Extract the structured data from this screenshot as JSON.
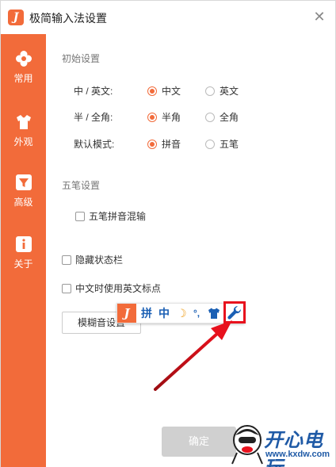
{
  "window": {
    "title": "极简输入法设置",
    "logo_letter": "J",
    "close_glyph": "✕"
  },
  "sidebar": {
    "items": [
      {
        "label": "常用",
        "icon": "flower-icon"
      },
      {
        "label": "外观",
        "icon": "tshirt-icon"
      },
      {
        "label": "高级",
        "icon": "funnel-icon"
      },
      {
        "label": "关于",
        "icon": "info-icon"
      }
    ]
  },
  "initial_settings": {
    "title": "初始设置",
    "rows": [
      {
        "label": "中 / 英文:",
        "options": [
          "中文",
          "英文"
        ],
        "selected": "中文"
      },
      {
        "label": "半 / 全角:",
        "options": [
          "半角",
          "全角"
        ],
        "selected": "半角"
      },
      {
        "label": "默认模式:",
        "options": [
          "拼音",
          "五笔"
        ],
        "selected": "拼音"
      }
    ]
  },
  "wubi_settings": {
    "title": "五笔设置",
    "mix_label": "五笔拼音混输"
  },
  "options": {
    "hide_status_bar": "隐藏状态栏",
    "english_punct": "中文时使用英文标点"
  },
  "fuzzy_button": "模糊音设置",
  "confirm_button": "确定",
  "floating_toolbar": {
    "logo_letter": "J",
    "pinyin": "拼",
    "chinese": "中",
    "moon": "☽",
    "punct": "°,",
    "shirt_icon": "tshirt-icon",
    "wrench_icon": "wrench-icon"
  },
  "watermark": {
    "brand": "开心电玩",
    "url": "www.kxdw.com"
  },
  "colors": {
    "accent": "#f26b3a",
    "highlight_box": "#e8111d",
    "arrow": "#d9141c",
    "toolbar_blue": "#1a5fb4"
  }
}
